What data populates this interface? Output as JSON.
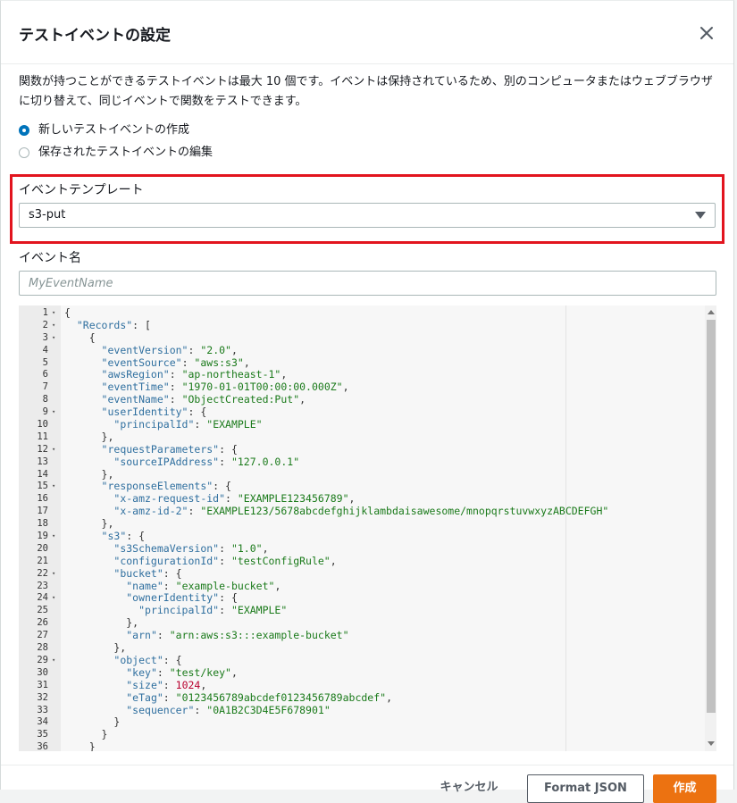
{
  "dialog": {
    "title": "テストイベントの設定",
    "description": "関数が持つことができるテストイベントは最大 10 個です。イベントは保持されているため、別のコンピュータまたはウェブブラウザに切り替えて、同じイベントで関数をテストできます。",
    "radio_options": [
      {
        "label": "新しいテストイベントの作成",
        "checked": true
      },
      {
        "label": "保存されたテストイベントの編集",
        "checked": false
      }
    ],
    "template_label": "イベントテンプレート",
    "template_value": "s3-put",
    "event_name_label": "イベント名",
    "event_name_placeholder": "MyEventName",
    "event_name_value": ""
  },
  "editor": {
    "lines": [
      {
        "n": "1",
        "fold": true,
        "text": "{"
      },
      {
        "n": "2",
        "fold": true,
        "text": "  \"Records\": ["
      },
      {
        "n": "3",
        "fold": true,
        "text": "    {"
      },
      {
        "n": "4",
        "fold": false,
        "text": "      \"eventVersion\": \"2.0\","
      },
      {
        "n": "5",
        "fold": false,
        "text": "      \"eventSource\": \"aws:s3\","
      },
      {
        "n": "6",
        "fold": false,
        "text": "      \"awsRegion\": \"ap-northeast-1\","
      },
      {
        "n": "7",
        "fold": false,
        "text": "      \"eventTime\": \"1970-01-01T00:00:00.000Z\","
      },
      {
        "n": "8",
        "fold": false,
        "text": "      \"eventName\": \"ObjectCreated:Put\","
      },
      {
        "n": "9",
        "fold": true,
        "text": "      \"userIdentity\": {"
      },
      {
        "n": "10",
        "fold": false,
        "text": "        \"principalId\": \"EXAMPLE\""
      },
      {
        "n": "11",
        "fold": false,
        "text": "      },"
      },
      {
        "n": "12",
        "fold": true,
        "text": "      \"requestParameters\": {"
      },
      {
        "n": "13",
        "fold": false,
        "text": "        \"sourceIPAddress\": \"127.0.0.1\""
      },
      {
        "n": "14",
        "fold": false,
        "text": "      },"
      },
      {
        "n": "15",
        "fold": true,
        "text": "      \"responseElements\": {"
      },
      {
        "n": "16",
        "fold": false,
        "text": "        \"x-amz-request-id\": \"EXAMPLE123456789\","
      },
      {
        "n": "17",
        "fold": false,
        "text": "        \"x-amz-id-2\": \"EXAMPLE123/5678abcdefghijklambdaisawesome/mnopqrstuvwxyzABCDEFGH\""
      },
      {
        "n": "18",
        "fold": false,
        "text": "      },"
      },
      {
        "n": "19",
        "fold": true,
        "text": "      \"s3\": {"
      },
      {
        "n": "20",
        "fold": false,
        "text": "        \"s3SchemaVersion\": \"1.0\","
      },
      {
        "n": "21",
        "fold": false,
        "text": "        \"configurationId\": \"testConfigRule\","
      },
      {
        "n": "22",
        "fold": true,
        "text": "        \"bucket\": {"
      },
      {
        "n": "23",
        "fold": false,
        "text": "          \"name\": \"example-bucket\","
      },
      {
        "n": "24",
        "fold": true,
        "text": "          \"ownerIdentity\": {"
      },
      {
        "n": "25",
        "fold": false,
        "text": "            \"principalId\": \"EXAMPLE\""
      },
      {
        "n": "26",
        "fold": false,
        "text": "          },"
      },
      {
        "n": "27",
        "fold": false,
        "text": "          \"arn\": \"arn:aws:s3:::example-bucket\""
      },
      {
        "n": "28",
        "fold": false,
        "text": "        },"
      },
      {
        "n": "29",
        "fold": true,
        "text": "        \"object\": {"
      },
      {
        "n": "30",
        "fold": false,
        "text": "          \"key\": \"test/key\","
      },
      {
        "n": "31",
        "fold": false,
        "text": "          \"size\": 1024,"
      },
      {
        "n": "32",
        "fold": false,
        "text": "          \"eTag\": \"0123456789abcdef0123456789abcdef\","
      },
      {
        "n": "33",
        "fold": false,
        "text": "          \"sequencer\": \"0A1B2C3D4E5F678901\""
      },
      {
        "n": "34",
        "fold": false,
        "text": "        }"
      },
      {
        "n": "35",
        "fold": false,
        "text": "      }"
      },
      {
        "n": "36",
        "fold": false,
        "text": "    }"
      }
    ]
  },
  "footer": {
    "cancel_label": "キャンセル",
    "format_label": "Format JSON",
    "create_label": "作成"
  },
  "colors": {
    "primary": "#ec7211",
    "radio_selected": "#0073bb",
    "highlight_border": "#e2141e"
  }
}
